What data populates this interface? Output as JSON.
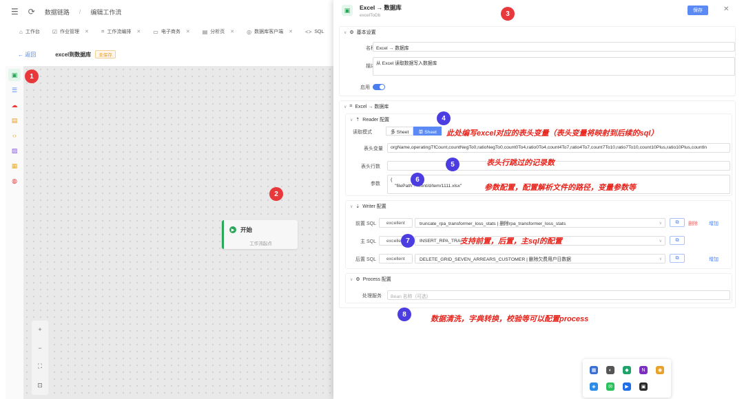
{
  "topbar": {
    "breadcrumb1": "数据链路",
    "breadcrumb_sep": "/",
    "breadcrumb2": "编辑工作流"
  },
  "tabs": [
    {
      "label": "工作台"
    },
    {
      "label": "作业管理"
    },
    {
      "label": "工作流编排"
    },
    {
      "label": "电子商务"
    },
    {
      "label": "分析页"
    },
    {
      "label": "数据库客户端"
    },
    {
      "label": "SQL"
    }
  ],
  "workflow": {
    "back": "← 返回",
    "title": "excel到数据库",
    "unsaved": "未保存"
  },
  "canvas": {
    "start_title": "开始",
    "start_sub": "工作流起点"
  },
  "drawer": {
    "title": "Excel → 数据库",
    "subtitle": "excelToDb",
    "save": "保存",
    "close": "✕",
    "basic": {
      "header": "基本设置",
      "name_label": "名称",
      "name_value": "Excel → 数据库",
      "desc_label": "描述",
      "desc_value": "从 Excel 读取数据写入数据库",
      "enable_label": "启用"
    },
    "excel_section": "Excel → 数据库",
    "reader": {
      "header": "Reader 配置",
      "mode_label": "读取模式",
      "mode_multi": "多 Sheet",
      "mode_single": "单 Sheet",
      "header_vars_label": "表头变量",
      "header_vars_value": "orgName,operatingTfCount,countNegTo0,ratioNegTo0,count0To4,ratio0To4,count4To7,ratio4To7,count7To10,ratio7To10,count10Plus,ratio10Plus,countIn",
      "header_rows_label": "表头行数",
      "params_label": "参数",
      "params_line1": "{",
      "params_line2": "\"filePath\": \"/mnt/d/tem/1111.xlsx\""
    },
    "writer": {
      "header": "Writer 配置",
      "pre_label": "前置 SQL",
      "main_label": "主 SQL",
      "post_label": "后置 SQL",
      "datasource": "excellent",
      "pre_sql": "truncate_rpa_transformer_loss_stats | 删除rpa_transformer_loss_stats",
      "main_sql": "INSERT_RPA_TRAN",
      "post_sql": "DELETE_GRID_SEVEN_ARREARS_CUSTOMER | 删除欠费用户日数据",
      "delete": "删除",
      "add": "增加"
    },
    "process": {
      "header": "Process 配置",
      "service_label": "处理服务",
      "service_placeholder": "Bean 名称（可选）"
    }
  },
  "annotations": {
    "b1": "1",
    "b2": "2",
    "b3": "3",
    "b4": "4",
    "b5": "5",
    "b6": "6",
    "b7": "7",
    "b8": "8",
    "note4": "此处编写excel对应的表头变量（表头变量将映射到后续的sql）",
    "note5": "表头行跳过的记录数",
    "note6": "参数配置，配置解析文件的路径，变量参数等",
    "note7": "支持前置，后置，主sql的配置",
    "note8": "数据清洗，字典转换，校验等可以配置process"
  },
  "colors": {
    "accent": "#5b8af5",
    "annotation_red": "#e8231b",
    "badge_red": "#e8383b",
    "badge_blue": "#4b3de0",
    "start_green": "#2aa85a"
  }
}
